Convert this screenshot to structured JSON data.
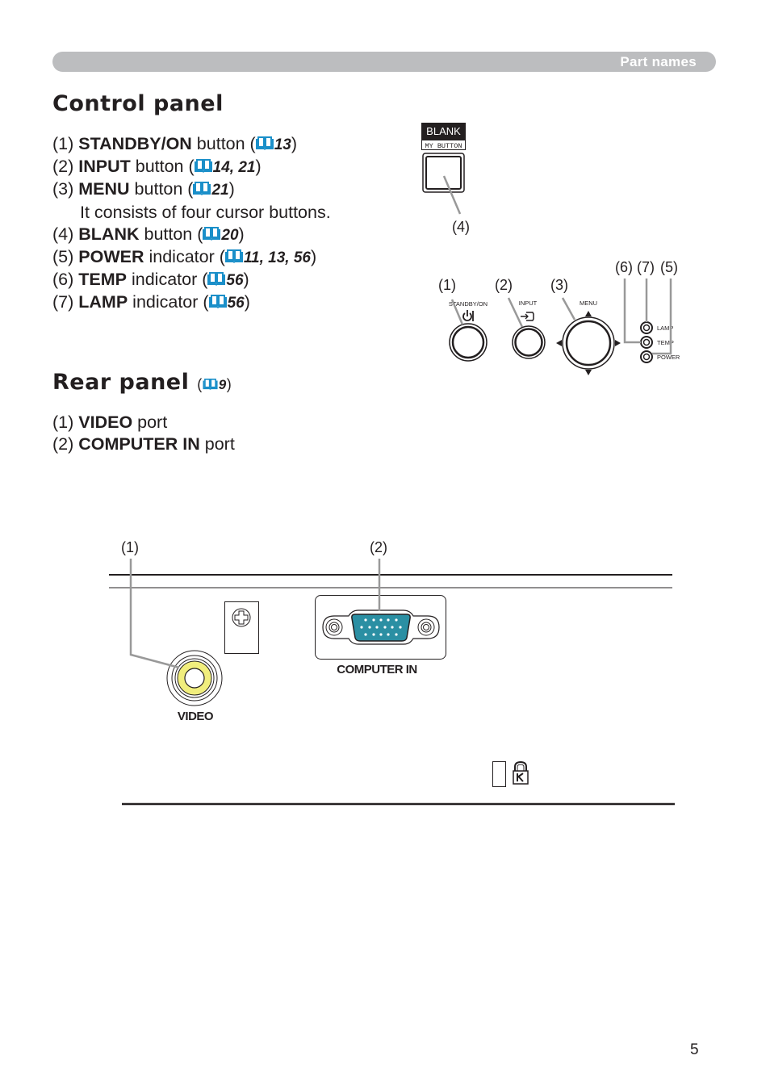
{
  "header": {
    "section_label": "Part names"
  },
  "control_panel": {
    "title": "Control panel",
    "items": [
      {
        "num": "(1)",
        "name": "STANDBY/ON",
        "suffix": " button (",
        "pages": "13",
        "close": ")"
      },
      {
        "num": "(2)",
        "name": "INPUT",
        "suffix": " button (",
        "pages": "14, 21",
        "close": ")"
      },
      {
        "num": "(3)",
        "name": "MENU",
        "suffix": " button (",
        "pages": "21",
        "close": ")"
      },
      {
        "note": "It consists of four cursor buttons."
      },
      {
        "num": "(4)",
        "name": "BLANK",
        "suffix": " button (",
        "pages": "20",
        "close": ")"
      },
      {
        "num": "(5)",
        "name": "POWER",
        "suffix": " indicator (",
        "pages": "11, 13, 56",
        "close": ")"
      },
      {
        "num": "(6)",
        "name": "TEMP",
        "suffix": " indicator (",
        "pages": "56",
        "close": ")"
      },
      {
        "num": "(7)",
        "name": "LAMP",
        "suffix": " indicator (",
        "pages": "56",
        "close": ")"
      }
    ],
    "diagram": {
      "blank_label": "BLANK",
      "my_button_label": "MY BUTTON",
      "callouts": [
        "(4)",
        "(1)",
        "(2)",
        "(3)",
        "(6)",
        "(7)",
        "(5)"
      ],
      "button_labels": {
        "standby": "STANDBY/ON",
        "input": "INPUT",
        "menu": "MENU"
      },
      "indicator_labels": {
        "lamp": "LAMP",
        "temp": "TEMP",
        "power": "POWER"
      }
    }
  },
  "rear_panel": {
    "title": "Rear panel",
    "ref_open": "(",
    "ref_page": "9",
    "ref_close": ")",
    "items": [
      {
        "num": "(1)",
        "name": "VIDEO",
        "suffix": " port"
      },
      {
        "num": "(2)",
        "name": "COMPUTER IN",
        "suffix": " port"
      }
    ],
    "diagram": {
      "callouts": [
        "(1)",
        "(2)"
      ],
      "video_label": "VIDEO",
      "computer_in_label": "COMPUTER IN"
    }
  },
  "colors": {
    "reference_blue": "#1a8fc9",
    "video_yellow": "#f1ee7d",
    "vga_teal": "#2b8fa3",
    "header_gray": "#bcbdbf"
  },
  "page_number": "5"
}
